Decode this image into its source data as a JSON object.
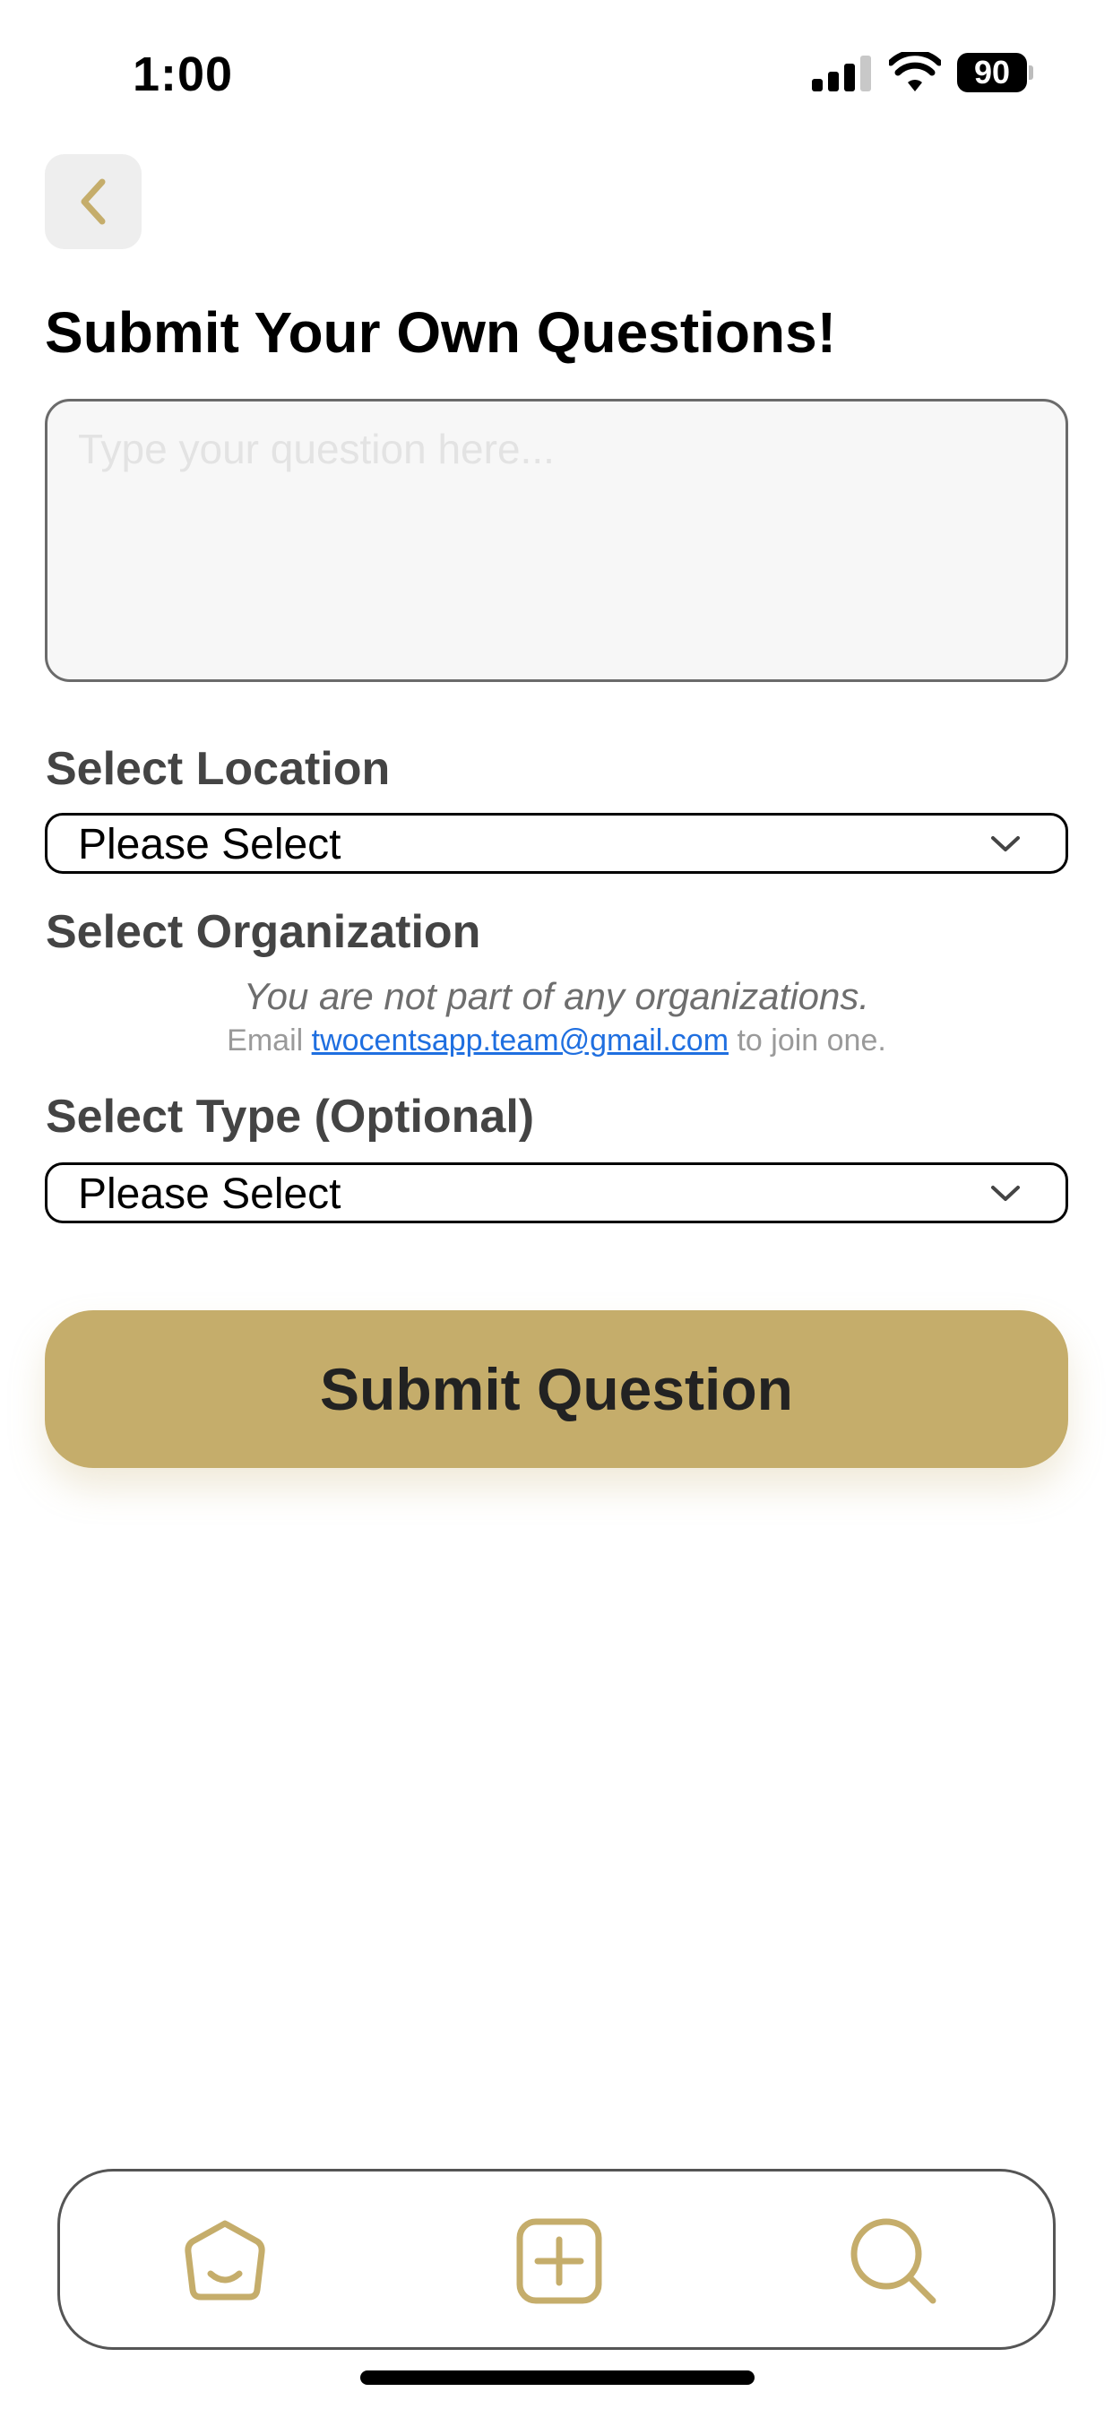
{
  "status_bar": {
    "time": "1:00",
    "battery_percent": "90",
    "signal_bars_active": 3,
    "signal_bars_total": 4
  },
  "header": {
    "back_icon": "chevron-left-icon",
    "title": "Submit Your Own Questions!"
  },
  "question_input": {
    "value": "",
    "placeholder": "Type your question here..."
  },
  "location": {
    "label": "Select Location",
    "selected": "Please Select"
  },
  "organization": {
    "label": "Select Organization",
    "empty_message": "You are not part of any organizations.",
    "contact_prefix": "Email",
    "contact_email": "twocentsapp.team@gmail.com",
    "contact_suffix": "to join one."
  },
  "type": {
    "label": "Select Type (Optional)",
    "selected": "Please Select"
  },
  "submit_button": {
    "label": "Submit Question"
  },
  "tab_bar": {
    "items": [
      {
        "icon": "home-smile-icon"
      },
      {
        "icon": "plus-square-icon"
      },
      {
        "icon": "search-icon"
      }
    ]
  },
  "colors": {
    "accent": "#c5ad6b",
    "link": "#1f6fe0",
    "label_text": "#444444"
  }
}
